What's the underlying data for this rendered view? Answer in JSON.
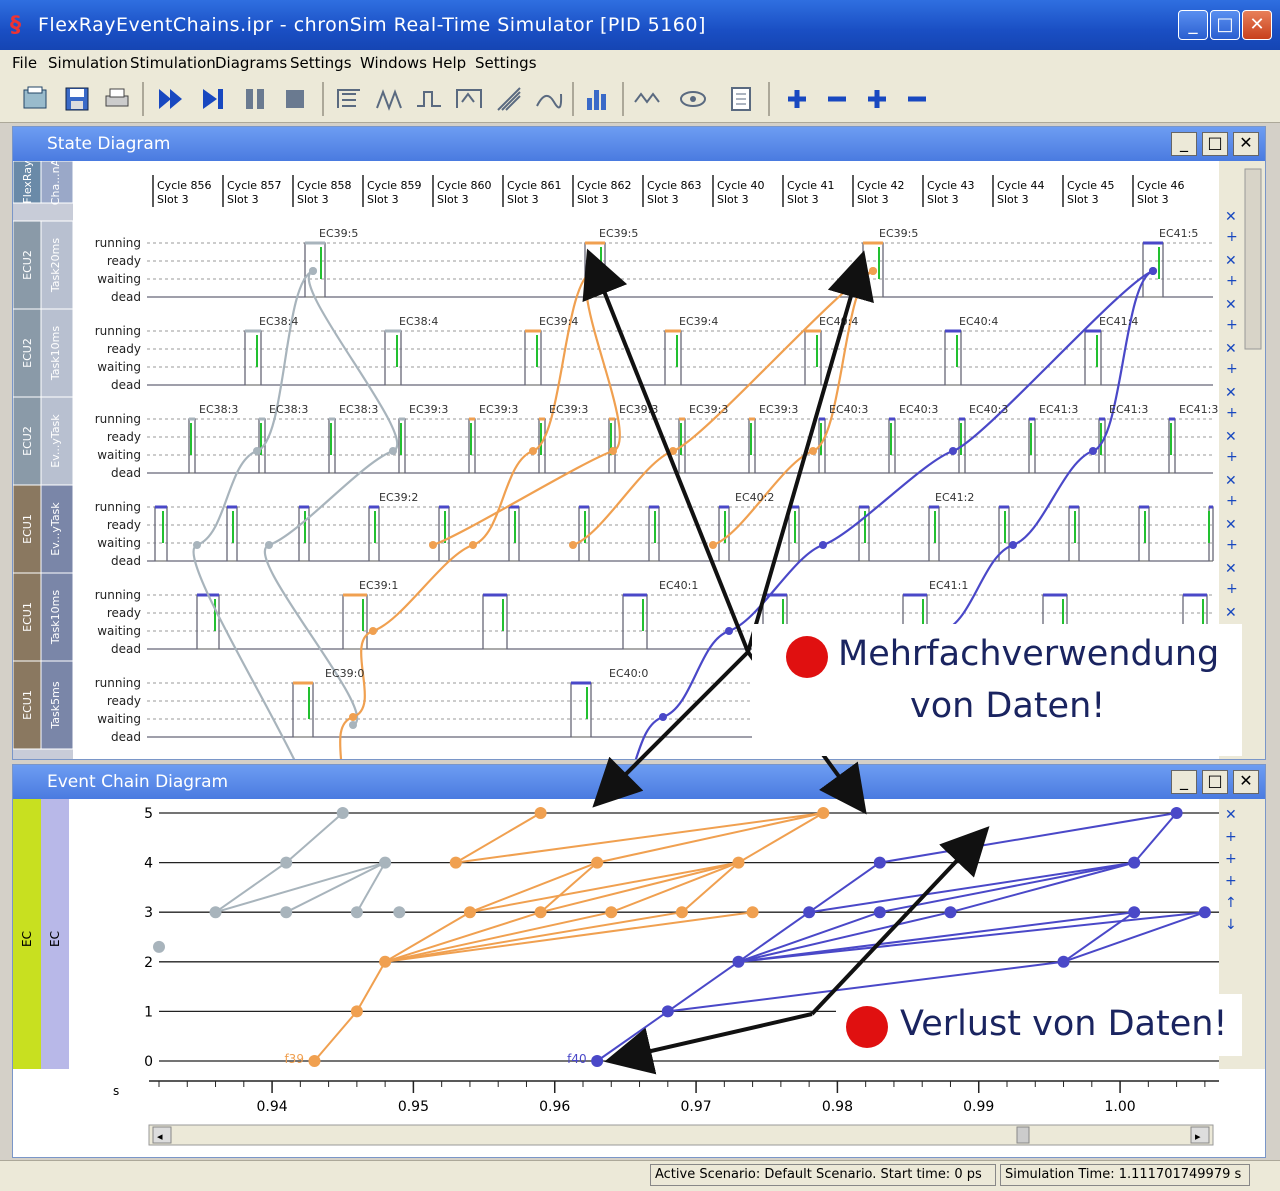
{
  "window": {
    "title": "FlexRayEventChains.ipr - chronSim Real-Time Simulator [PID 5160]"
  },
  "menu": [
    "File",
    "Simulation",
    "Stimulation",
    "Diagrams",
    "Settings",
    "Windows",
    "Help",
    "Settings"
  ],
  "state_diagram": {
    "title": "State Diagram",
    "states": [
      "running",
      "ready",
      "waiting",
      "dead"
    ],
    "rows": [
      {
        "ecu": "FlexRay",
        "task": "Cha...nA"
      },
      {
        "ecu": "ECU2",
        "task": "Task20ms"
      },
      {
        "ecu": "ECU2",
        "task": "Task10ms"
      },
      {
        "ecu": "ECU2",
        "task": "Ev...yTask"
      },
      {
        "ecu": "ECU1",
        "task": "Ev...yTask"
      },
      {
        "ecu": "ECU1",
        "task": "Task10ms"
      },
      {
        "ecu": "ECU1",
        "task": "Task5ms"
      }
    ],
    "cycles": [
      {
        "c": "Cycle 856",
        "s": "Slot 3"
      },
      {
        "c": "Cycle 857",
        "s": "Slot 3"
      },
      {
        "c": "Cycle 858",
        "s": "Slot 3"
      },
      {
        "c": "Cycle 859",
        "s": "Slot 3"
      },
      {
        "c": "Cycle 860",
        "s": "Slot 3"
      },
      {
        "c": "Cycle 861",
        "s": "Slot 3"
      },
      {
        "c": "Cycle 862",
        "s": "Slot 3"
      },
      {
        "c": "Cycle 863",
        "s": "Slot 3"
      },
      {
        "c": "Cycle 40",
        "s": "Slot 3"
      },
      {
        "c": "Cycle 41",
        "s": "Slot 3"
      },
      {
        "c": "Cycle 42",
        "s": "Slot 3"
      },
      {
        "c": "Cycle 43",
        "s": "Slot 3"
      },
      {
        "c": "Cycle 44",
        "s": "Slot 3"
      },
      {
        "c": "Cycle 45",
        "s": "Slot 3"
      },
      {
        "c": "Cycle 46",
        "s": "Slot 3"
      }
    ],
    "event_labels": {
      "row1": [
        "EC39:5",
        "EC39:5",
        "EC39:5",
        "EC41:5"
      ],
      "row2": [
        "EC38:4",
        "EC38:4",
        "EC39:4",
        "EC39:4",
        "EC40:4",
        "EC40:4",
        "EC41:4"
      ],
      "row3": [
        "EC38:3",
        "EC38:3",
        "EC38:3",
        "EC39:3",
        "EC39:3",
        "EC39:3",
        "EC39:3",
        "EC39:3",
        "EC39:3",
        "EC40:3",
        "EC40:3",
        "EC40:3",
        "EC41:3",
        "EC41:3",
        "EC41:3"
      ],
      "row4": [
        "EC39:2",
        "EC40:2",
        "EC41:2"
      ],
      "row5": [
        "EC39:1",
        "EC40:1",
        "EC41:1"
      ],
      "row6": [
        "EC39:0",
        "EC40:0"
      ]
    }
  },
  "event_chain_diagram": {
    "title": "Event Chain Diagram",
    "side_labels": [
      "EC",
      "EC"
    ],
    "y_ticks": [
      "5",
      "4",
      "3",
      "2",
      "1",
      "0"
    ],
    "x_ticks": [
      "0.94",
      "0.95",
      "0.96",
      "0.97",
      "0.98",
      "0.99",
      "1.00"
    ],
    "x_unit": "s",
    "point_labels": [
      "f39",
      "f40"
    ]
  },
  "annotations": {
    "reuse": "Mehrfachverwendung von Daten!",
    "reuse_line1": "Mehrfachverwendung",
    "reuse_line2": "von Daten!",
    "loss": "Verlust von Daten!"
  },
  "status": {
    "scenario": "Active Scenario: Default Scenario. Start time: 0 ps",
    "sim_time": "Simulation Time: 1.111701749979 s"
  },
  "colors": {
    "orange": "#f0a050",
    "blue": "#4a48c8",
    "grey": "#a8b4bc",
    "green": "#22c030",
    "titlebar": "#1a4fc4"
  },
  "chart_data": {
    "type": "line",
    "xlabel": "s",
    "ylim": [
      0,
      5
    ],
    "xlim": [
      0.932,
      1.007
    ],
    "series": [
      {
        "color": "grey",
        "points": [
          [
            0.932,
            2.3
          ],
          [
            0.936,
            3
          ],
          [
            0.941,
            4
          ],
          [
            0.945,
            5
          ],
          [
            0.941,
            3
          ],
          [
            0.946,
            3
          ],
          [
            0.948,
            4
          ],
          [
            0.949,
            3
          ]
        ]
      },
      {
        "color": "orange",
        "points": [
          [
            0.943,
            0
          ],
          [
            0.946,
            1
          ],
          [
            0.948,
            2
          ],
          [
            0.954,
            3
          ],
          [
            0.959,
            3
          ],
          [
            0.964,
            3
          ],
          [
            0.969,
            3
          ],
          [
            0.974,
            3
          ],
          [
            0.953,
            4
          ],
          [
            0.963,
            4
          ],
          [
            0.973,
            4
          ],
          [
            0.959,
            5
          ],
          [
            0.979,
            5
          ]
        ]
      },
      {
        "color": "blue",
        "points": [
          [
            0.963,
            0
          ],
          [
            0.968,
            1
          ],
          [
            0.973,
            2
          ],
          [
            0.978,
            3
          ],
          [
            0.983,
            3
          ],
          [
            0.988,
            3
          ],
          [
            0.983,
            4
          ],
          [
            0.996,
            2
          ],
          [
            1.001,
            3
          ],
          [
            1.006,
            3
          ],
          [
            1.001,
            4
          ],
          [
            1.004,
            5
          ]
        ]
      }
    ]
  }
}
